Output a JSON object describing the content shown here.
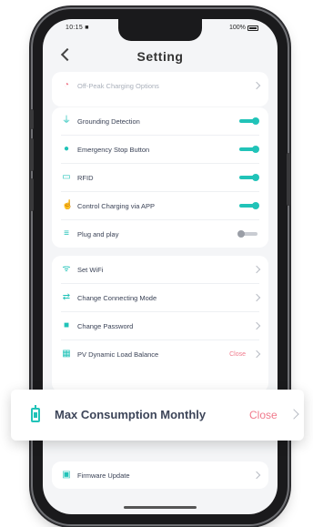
{
  "status_bar": {
    "time": "10:15 ■",
    "battery": "100%"
  },
  "header": {
    "title": "Setting"
  },
  "top_row": {
    "label": "Off-Peak Charging Options"
  },
  "toggle_section": [
    {
      "label": "Grounding Detection",
      "icon": "ground-icon",
      "on": true
    },
    {
      "label": "Emergency Stop Button",
      "icon": "stop-button-icon",
      "on": true
    },
    {
      "label": "RFID",
      "icon": "rfid-icon",
      "on": true
    },
    {
      "label": "Control Charging via APP",
      "icon": "app-control-icon",
      "on": true
    },
    {
      "label": "Plug and play",
      "icon": "plug-icon",
      "on": false
    }
  ],
  "menu_section": [
    {
      "label": "Set WiFi",
      "icon": "wifi-icon",
      "value": ""
    },
    {
      "label": "Change Connecting Mode",
      "icon": "swap-icon",
      "value": ""
    },
    {
      "label": "Change Password",
      "icon": "lock-icon",
      "value": ""
    },
    {
      "label": "PV Dynamic Load Balance",
      "icon": "solar-icon",
      "value": "Close"
    }
  ],
  "popup": {
    "label": "Max Consumption Monthly",
    "value": "Close",
    "icon": "meter-icon"
  },
  "firmware": {
    "label": "Firmware Update",
    "icon": "firmware-icon"
  },
  "colors": {
    "accent": "#21c3b8",
    "close_text": "#f07a8c",
    "label_text": "#3a4256"
  }
}
